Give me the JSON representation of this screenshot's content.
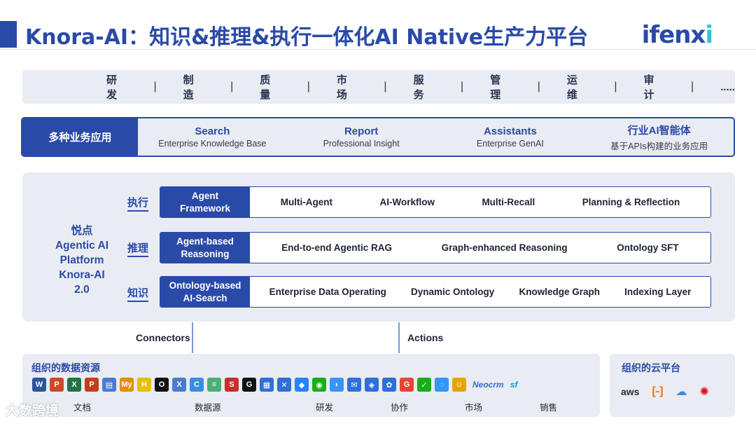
{
  "title": "Knora-AI：知识&推理&执行一体化AI Native生产力平台",
  "logo": {
    "main": "ifenx",
    "tail": "i"
  },
  "departments": [
    "研发",
    "制造",
    "质量",
    "市场",
    "服务",
    "管理",
    "运维",
    "审计",
    "....."
  ],
  "separator": "|",
  "apps": {
    "label": "多种业务应用",
    "items": [
      {
        "title": "Search",
        "subtitle": "Enterprise Knowledge Base"
      },
      {
        "title": "Report",
        "subtitle": "Professional Insight"
      },
      {
        "title": "Assistants",
        "subtitle": "Enterprise GenAI"
      },
      {
        "title": "行业AI智能体",
        "subtitle": "基于APIs构建的业务应用"
      }
    ]
  },
  "platform": {
    "name_lines": [
      "悦点",
      "Agentic AI",
      "Platform",
      "Knora-AI 2.0"
    ],
    "layers": [
      {
        "tag": "执行",
        "head_lines": [
          "Agent",
          "Framework"
        ],
        "items": [
          "Multi-Agent",
          "AI-Workflow",
          "Multi-Recall",
          "Planning & Reflection"
        ]
      },
      {
        "tag": "推理",
        "head_lines": [
          "Agent-based",
          "Reasoning"
        ],
        "items": [
          "End-to-end Agentic RAG",
          "Graph-enhanced Reasoning",
          "Ontology SFT"
        ]
      },
      {
        "tag": "知识",
        "head_lines": [
          "Ontology-based",
          "AI-Search"
        ],
        "items": [
          "Enterprise Data Operating",
          "Dynamic Ontology",
          "Knowledge Graph",
          "Indexing Layer"
        ]
      }
    ]
  },
  "connectors_label": "Connectors",
  "actions_label": "Actions",
  "sources": {
    "title": "组织的数据资源",
    "icons": [
      {
        "name": "word-icon",
        "glyph": "W",
        "color": "#2b579a"
      },
      {
        "name": "powerpoint-icon",
        "glyph": "P",
        "color": "#d24726"
      },
      {
        "name": "excel-icon",
        "glyph": "X",
        "color": "#217346"
      },
      {
        "name": "powerpoint-icon-2",
        "glyph": "P",
        "color": "#c43e1c"
      },
      {
        "name": "file-icon",
        "glyph": "▤",
        "color": "#4a7bd0"
      },
      {
        "name": "mysql-icon",
        "glyph": "My",
        "color": "#e48e00"
      },
      {
        "name": "hadoop-icon",
        "glyph": "H",
        "color": "#e5c000"
      },
      {
        "name": "circle-icon",
        "glyph": "O",
        "color": "#111111"
      },
      {
        "name": "xml-icon",
        "glyph": "X",
        "color": "#4a7bd0"
      },
      {
        "name": "confluence-icon",
        "glyph": "C",
        "color": "#3a8de0"
      },
      {
        "name": "layers-icon",
        "glyph": "≡",
        "color": "#4caf7a"
      },
      {
        "name": "scala-icon",
        "glyph": "S",
        "color": "#c4302b"
      },
      {
        "name": "github-icon",
        "glyph": "G",
        "color": "#111111"
      },
      {
        "name": "board-icon",
        "glyph": "▦",
        "color": "#2f6fd6"
      },
      {
        "name": "cross-icon",
        "glyph": "✕",
        "color": "#2f6fd6"
      },
      {
        "name": "jira-icon",
        "glyph": "◆",
        "color": "#2684ff"
      },
      {
        "name": "wechat-icon",
        "glyph": "◉",
        "color": "#1aad19"
      },
      {
        "name": "dingtalk-icon",
        "glyph": "◗",
        "color": "#3296fa"
      },
      {
        "name": "mail-icon",
        "glyph": "✉",
        "color": "#2f6fd6"
      },
      {
        "name": "app-icon",
        "glyph": "◈",
        "color": "#2f6fd6"
      },
      {
        "name": "paw-icon",
        "glyph": "✿",
        "color": "#2f6fd6"
      },
      {
        "name": "google-icon",
        "glyph": "G",
        "color": "#ea4335"
      },
      {
        "name": "chat-icon",
        "glyph": "✓",
        "color": "#1aad19"
      },
      {
        "name": "bubble-icon",
        "glyph": "◌",
        "color": "#3296fa"
      },
      {
        "name": "mascot-icon",
        "glyph": "☺",
        "color": "#e5a400"
      }
    ],
    "brands": [
      {
        "name": "neocrm-logo",
        "text": "Neocrm",
        "color": "#2f6fd6"
      },
      {
        "name": "salesforce-logo",
        "text": "sf",
        "color": "#00a1e0"
      }
    ],
    "categories": [
      "文档",
      "数据源",
      "研发",
      "协作",
      "市场",
      "销售"
    ]
  },
  "cloud": {
    "title": "组织的云平台",
    "aws": "aws",
    "icons": [
      {
        "name": "aliyun-icon",
        "glyph": "[-]",
        "color": "#ff6a00"
      },
      {
        "name": "cloud-icon",
        "glyph": "☁",
        "color": "#3a8de0"
      },
      {
        "name": "huawei-icon",
        "glyph": "✺",
        "color": "#e60012"
      }
    ]
  },
  "watermark": "大数跨境"
}
